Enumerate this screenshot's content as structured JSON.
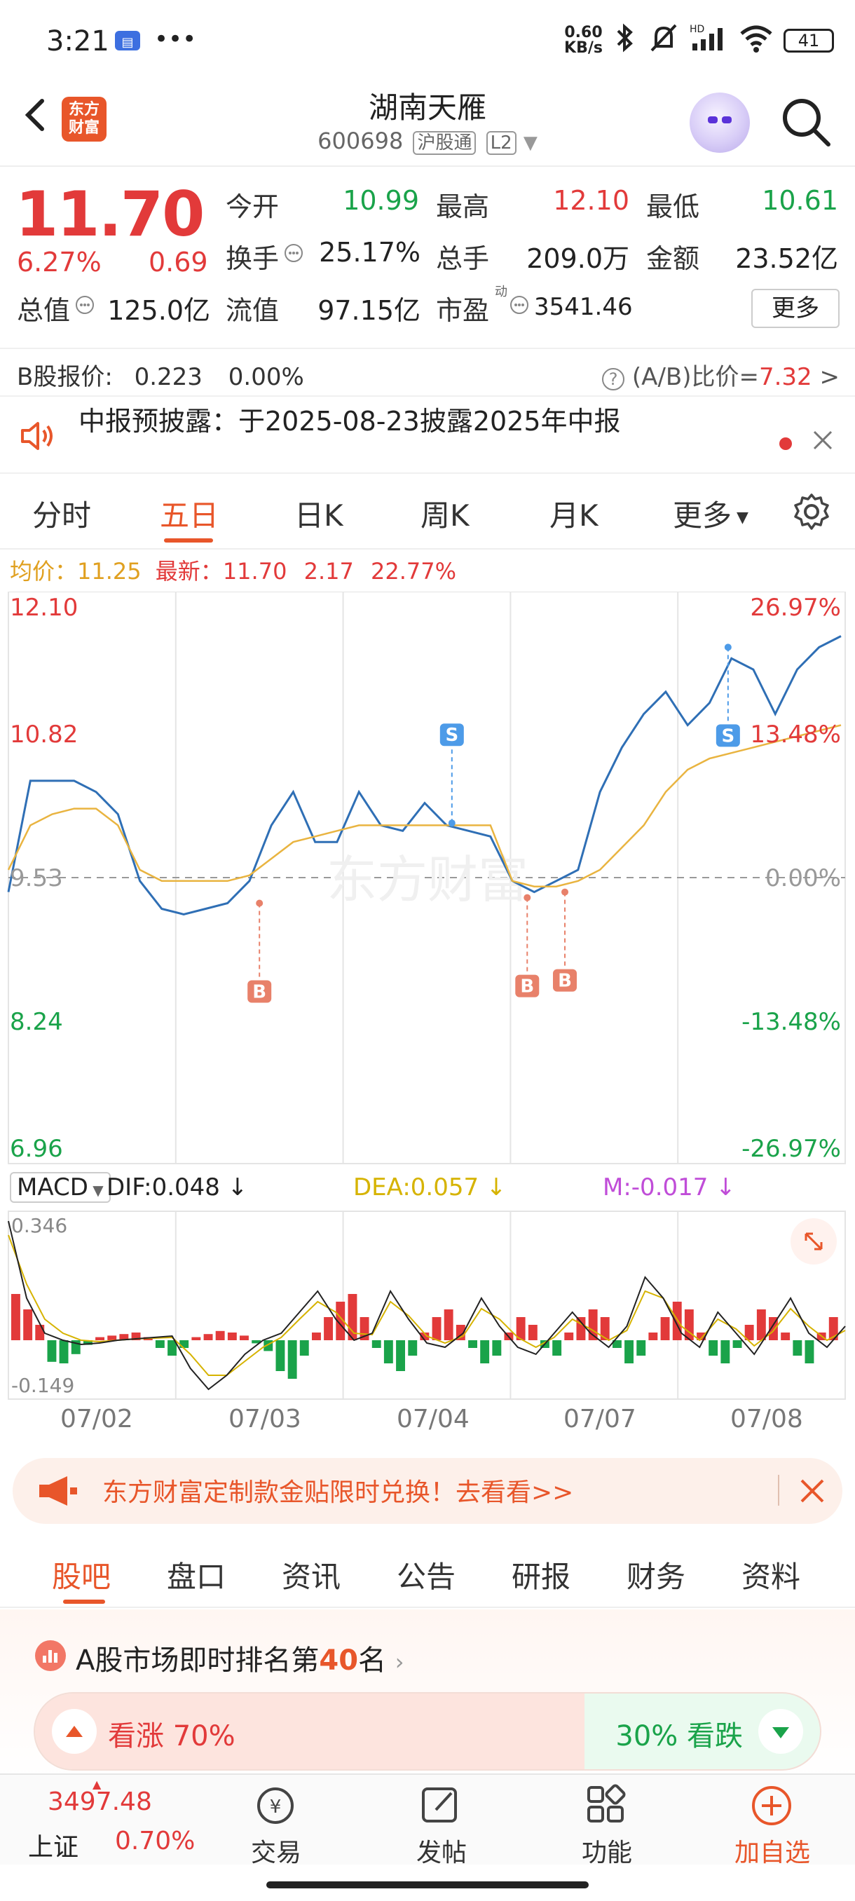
{
  "status_bar": {
    "time": "3:21",
    "speed": "0.60\nKB/s",
    "battery": "41"
  },
  "header": {
    "brand_logo_text": "东方\n财富",
    "stock_name": "湖南天雁",
    "stock_code": "600698",
    "tag_connect": "沪股通",
    "tag_level": "L2"
  },
  "quote": {
    "price": "11.70",
    "change_pct": "6.27%",
    "change": "0.69",
    "rows": [
      [
        {
          "label": "今开",
          "value": "10.99",
          "color": "green"
        },
        {
          "label": "最高",
          "value": "12.10",
          "color": "red"
        },
        {
          "label": "最低",
          "value": "10.61",
          "color": "green"
        }
      ],
      [
        {
          "label": "换手",
          "value": "25.17%",
          "color": "dark"
        },
        {
          "label": "总手",
          "value": "209.0万",
          "color": "dark"
        },
        {
          "label": "金额",
          "value": "23.52亿",
          "color": "dark"
        }
      ],
      [
        {
          "label": "总值",
          "value": "125.0亿",
          "color": "dark"
        },
        {
          "label": "流值",
          "value": "97.15亿",
          "color": "dark"
        },
        {
          "label": "市盈",
          "value": "3541.46",
          "color": "dark"
        }
      ]
    ],
    "more_label": "更多",
    "pe_sup": "动"
  },
  "b_share": {
    "label": "B股报价:",
    "price": "0.223",
    "pct": "0.00%",
    "ratio_label": "(A/B)比价=",
    "ratio_value": "7.32"
  },
  "notice": {
    "text": "中报预披露：于2025-08-23披露2025年中报"
  },
  "chart_tabs": [
    "分时",
    "五日",
    "日K",
    "周K",
    "月K",
    "更多"
  ],
  "avg_line": {
    "avg_label": "均价：",
    "avg_value": "11.25",
    "latest_label": "最新：",
    "latest_value": "11.70",
    "change": "2.17",
    "pct": "22.77%"
  },
  "watermark": "东方财富",
  "chart_data": {
    "type": "line",
    "title": "",
    "x": [
      "07/02",
      "07/03",
      "07/04",
      "07/07",
      "07/08"
    ],
    "ylim": [
      6.96,
      12.1
    ],
    "y_ticks": [
      "12.10",
      "10.82",
      "9.53",
      "8.24",
      "6.96"
    ],
    "y_pct_ticks": [
      "26.97%",
      "13.48%",
      "0.00%",
      "-13.48%",
      "-26.97%"
    ],
    "prev_close": 9.53,
    "series": [
      {
        "name": "price",
        "color": "#2f6fb5",
        "values": [
          9.4,
          10.4,
          10.4,
          10.4,
          10.3,
          10.1,
          9.5,
          9.25,
          9.2,
          9.25,
          9.3,
          9.5,
          10.0,
          10.3,
          9.85,
          9.85,
          10.3,
          10.0,
          9.95,
          10.2,
          10.0,
          9.95,
          9.9,
          9.5,
          9.4,
          9.5,
          9.6,
          10.3,
          10.7,
          11.0,
          11.2,
          10.9,
          11.1,
          11.5,
          11.4,
          11.0,
          11.4,
          11.6,
          11.7
        ]
      },
      {
        "name": "average",
        "color": "#e9b440",
        "values": [
          9.6,
          10.0,
          10.1,
          10.15,
          10.15,
          10.0,
          9.6,
          9.5,
          9.5,
          9.5,
          9.5,
          9.55,
          9.7,
          9.85,
          9.9,
          9.95,
          10.0,
          10.0,
          10.0,
          10.0,
          10.0,
          10.0,
          10.0,
          9.5,
          9.45,
          9.45,
          9.5,
          9.6,
          9.8,
          10.0,
          10.3,
          10.5,
          10.6,
          10.65,
          10.7,
          10.75,
          10.8,
          10.85,
          10.9
        ]
      }
    ],
    "markers": [
      {
        "label": "B",
        "day": "07/03"
      },
      {
        "label": "S",
        "day": "07/04"
      },
      {
        "label": "B",
        "day": "07/07"
      },
      {
        "label": "B",
        "day": "07/07"
      },
      {
        "label": "S",
        "day": "07/08"
      }
    ]
  },
  "macd": {
    "select_label": "MACD",
    "dif": "DIF:0.048",
    "dea": "DEA:0.057",
    "m": "M:-0.017",
    "top_value": "0.346",
    "bottom_value": "-0.149",
    "colors": {
      "dif": "#222222",
      "dea": "#d6b300",
      "m": "#c04dd8"
    }
  },
  "promo": {
    "text": "东方财富定制款金贴限时兑换！去看看>>"
  },
  "bottom_tabs": [
    "股吧",
    "盘口",
    "资讯",
    "公告",
    "研报",
    "财务",
    "资料"
  ],
  "rank": {
    "prefix": "A股市场即时排名第",
    "number": "40",
    "suffix": "名"
  },
  "vote": {
    "up_label": "看涨",
    "up_pct": "70%",
    "down_label": "看跌",
    "down_pct": "30%",
    "up_fraction": 0.7
  },
  "bottom_nav": {
    "index_value": "3497.48",
    "index_name": "上证",
    "index_pct": "0.70%",
    "items": [
      "交易",
      "发帖",
      "功能",
      "加自选"
    ]
  }
}
